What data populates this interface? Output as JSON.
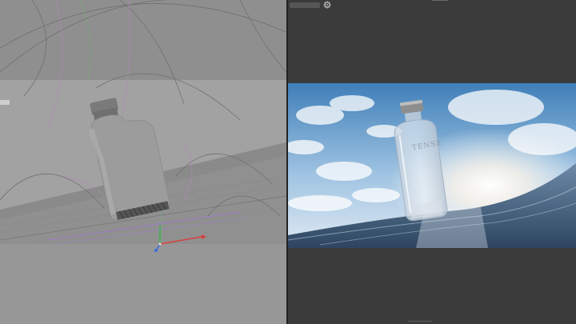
{
  "toolbar": {
    "render_select_label": "",
    "icons": [
      "gear-icon"
    ]
  },
  "render": {
    "bottle_label_text": "TENSE"
  },
  "colors": {
    "viewport_bg": "#9a9a9a",
    "panel_bg": "#3b3b3b",
    "sky_top": "#3f7fb8",
    "sky_bottom": "#dfe9f3",
    "water": "#4f6f8f",
    "axis_x": "#d84040",
    "axis_y": "#3cb24f",
    "axis_z": "#3c6ee0"
  }
}
